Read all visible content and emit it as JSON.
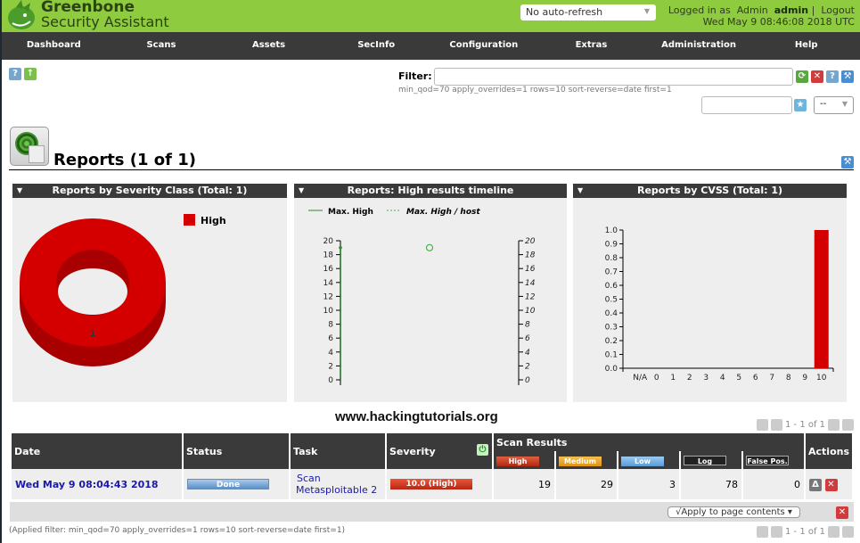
{
  "app": {
    "brand_line1": "Greenbone",
    "brand_line2": "Security Assistant",
    "auto_refresh": "No auto-refresh",
    "logged_in_prefix": "Logged in as",
    "role": "Admin",
    "username": "admin",
    "logout": "Logout",
    "datetime": "Wed May 9 08:46:08 2018 UTC"
  },
  "nav": [
    "Dashboard",
    "Scans",
    "Assets",
    "SecInfo",
    "Configuration",
    "Extras",
    "Administration",
    "Help"
  ],
  "filter": {
    "label": "Filter:",
    "value": "",
    "applied_text": "min_qod=70 apply_overrides=1 rows=10 sort-reverse=date first=1",
    "saved_select": "--"
  },
  "page": {
    "title": "Reports (1 of 1)"
  },
  "watermark": "www.hackingtutorials.org",
  "pager": {
    "text": "1 - 1 of 1"
  },
  "chart_data": [
    {
      "type": "pie",
      "title": "Reports by Severity Class (Total: 1)",
      "categories": [
        "High"
      ],
      "values": [
        1
      ],
      "colors": [
        "#d40000"
      ],
      "legend": "top-right"
    },
    {
      "type": "line",
      "title": "Reports: High results timeline",
      "series": [
        {
          "name": "Max. High",
          "values": [
            19
          ]
        },
        {
          "name": "Max. High / host",
          "values": [
            19
          ]
        }
      ],
      "ylim": [
        0,
        20
      ],
      "y_ticks": [
        0,
        2,
        4,
        6,
        8,
        10,
        12,
        14,
        16,
        18,
        20
      ],
      "y2_ticks": [
        0,
        2,
        4,
        6,
        8,
        10,
        12,
        14,
        16,
        18,
        20
      ],
      "legend": "top-left"
    },
    {
      "type": "bar",
      "title": "Reports by CVSS (Total: 1)",
      "categories": [
        "N/A",
        "0",
        "1",
        "2",
        "3",
        "4",
        "5",
        "6",
        "7",
        "8",
        "9",
        "10"
      ],
      "values": [
        0,
        0,
        0,
        0,
        0,
        0,
        0,
        0,
        0,
        0,
        0,
        1
      ],
      "ylim": [
        0,
        1.0
      ],
      "y_ticks": [
        "0.0",
        "0.1",
        "0.2",
        "0.3",
        "0.4",
        "0.5",
        "0.6",
        "0.7",
        "0.8",
        "0.9",
        "1.0"
      ],
      "bar_color": "#d40000"
    }
  ],
  "table": {
    "headers": {
      "date": "Date",
      "status": "Status",
      "task": "Task",
      "severity": "Severity",
      "scan_results": "Scan Results",
      "actions": "Actions"
    },
    "result_cols": [
      "High",
      "Medium",
      "Low",
      "Log",
      "False Pos."
    ],
    "rows": [
      {
        "date": "Wed May 9 08:04:43 2018",
        "status": "Done",
        "task_line1": "Scan",
        "task_line2": "Metasploitable 2",
        "severity": "10.0 (High)",
        "high": "19",
        "medium": "29",
        "low": "3",
        "log": "78",
        "false_pos": "0"
      }
    ],
    "apply_label": "√Apply to page contents ▾",
    "applied_filter": "(Applied filter: min_qod=70 apply_overrides=1 rows=10 sort-reverse=date first=1)"
  }
}
